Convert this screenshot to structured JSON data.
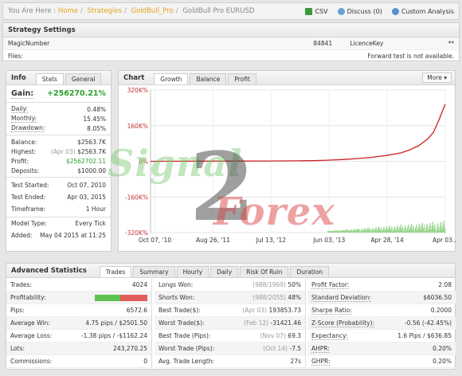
{
  "breadcrumb": {
    "prefix": "You Are Here :",
    "home": "Home",
    "strategies": "Strategies",
    "strategy": "GoldBull_Pro",
    "current": "GoldBull Pro EURUSD"
  },
  "toolbar": {
    "csv": "CSV",
    "discuss": "Discuss (0)",
    "custom": "Custom Analysis"
  },
  "settings": {
    "title": "Strategy Settings",
    "magic_label": "MagicNumber",
    "magic_value": "84841",
    "licence_label": "LicenceKey",
    "licence_value": "**",
    "files_label": "Files:",
    "forward_note": "Forward test is not available."
  },
  "info": {
    "title": "Info",
    "tab_stats": "Stats",
    "tab_general": "General",
    "gain_label": "Gain:",
    "gain_value": "+256270.21%",
    "daily_label": "Daily:",
    "daily": "0.48%",
    "monthly_label": "Monthly:",
    "monthly": "15.45%",
    "drawdown_label": "Drawdown:",
    "drawdown": "8.05%",
    "balance_label": "Balance:",
    "balance": "$2563.7K",
    "highest_label": "Highest:",
    "highest_date": "(Apr 03)",
    "highest": "$2563.7K",
    "profit_label": "Profit:",
    "profit": "$2562702.11",
    "deposits_label": "Deposits:",
    "deposits": "$1000.00",
    "started_label": "Test Started:",
    "started": "Oct 07, 2010",
    "ended_label": "Test Ended:",
    "ended": "Apr 03, 2015",
    "timeframe_label": "Timeframe:",
    "timeframe": "1 Hour",
    "model_label": "Model Type:",
    "model": "Every Tick",
    "added_label": "Added:",
    "added": "May 04 2015 at 11:25"
  },
  "chart": {
    "title": "Chart",
    "tab_growth": "Growth",
    "tab_balance": "Balance",
    "tab_profit": "Profit",
    "more": "More",
    "watermark_top": "Signal",
    "watermark_2": "2",
    "watermark_bottom": "Forex"
  },
  "chart_data": {
    "type": "line",
    "yticks": [
      "320K%",
      "160K%",
      "0%",
      "-160K%",
      "-320K%"
    ],
    "ytick_values": [
      320000,
      160000,
      0,
      -160000,
      -320000
    ],
    "ylim": [
      -320000,
      320000
    ],
    "xticks": [
      "Oct 07, '10",
      "Aug 26, '11",
      "Jul 13, '12",
      "Jun 03, '13",
      "Apr 28, '14",
      "Apr 03..."
    ],
    "xlim": [
      0,
      100
    ],
    "series": [
      {
        "x": [
          0,
          10,
          20,
          30,
          40,
          50,
          55,
          60,
          65,
          70,
          75,
          80,
          85,
          88,
          91,
          94,
          96,
          97,
          98,
          99,
          100
        ],
        "values": [
          0,
          300,
          600,
          900,
          1300,
          2000,
          3000,
          5000,
          8000,
          12000,
          18000,
          26000,
          38000,
          52000,
          70000,
          100000,
          130000,
          160000,
          190000,
          225000,
          256270
        ]
      }
    ],
    "color": "#cc2222",
    "volume_color": "#9bd68f"
  },
  "advanced": {
    "title": "Advanced Statistics",
    "tabs": [
      "Trades",
      "Summary",
      "Hourly",
      "Daily",
      "Risk Of Ruin",
      "Duration"
    ],
    "col1": [
      {
        "k": "Trades:",
        "v": "4024"
      },
      {
        "k": "Profitability:",
        "v": ""
      },
      {
        "k": "Pips:",
        "v": "6572.6"
      },
      {
        "k": "Average Win:",
        "v": "4.75 pips / $2501.50"
      },
      {
        "k": "Average Loss:",
        "v": "-1.38 pips / -$1162.24"
      },
      {
        "k": "Lots:",
        "v": "243,270.25"
      },
      {
        "k": "Commissions:",
        "v": "0"
      }
    ],
    "col2": [
      {
        "k": "Longs Won:",
        "sub": "(988/1969)",
        "v": "50%"
      },
      {
        "k": "Shorts Won:",
        "sub": "(988/2055)",
        "v": "48%"
      },
      {
        "k": "Best Trade($):",
        "sub": "(Apr 03)",
        "v": "193853.73"
      },
      {
        "k": "Worst Trade($):",
        "sub": "(Feb 12)",
        "v": "-31421.46"
      },
      {
        "k": "Best Trade (Pips):",
        "sub": "(Nov 07)",
        "v": "69.3"
      },
      {
        "k": "Worst Trade (Pips):",
        "sub": "(Oct 14)",
        "v": "-7.5"
      },
      {
        "k": "Avg. Trade Length:",
        "sub": "",
        "v": "27s"
      }
    ],
    "col3": [
      {
        "k": "Profit Factor:",
        "v": "2.08"
      },
      {
        "k": "Standard Deviation:",
        "v": "$6036.50"
      },
      {
        "k": "Sharpe Ratio:",
        "v": "0.2000"
      },
      {
        "k": "Z-Score (Probability):",
        "v": "-0.56 (-42.45%)"
      },
      {
        "k": "Expectancy:",
        "v": "1.6 Pips / $636.85"
      },
      {
        "k": "AHPR:",
        "v": "0.20%"
      },
      {
        "k": "GHPR:",
        "v": "0.20%"
      }
    ],
    "profitability_won": 0.49
  },
  "colors": {
    "accent": "#e7a21b",
    "green": "#2aa02a",
    "red": "#cc2222"
  }
}
